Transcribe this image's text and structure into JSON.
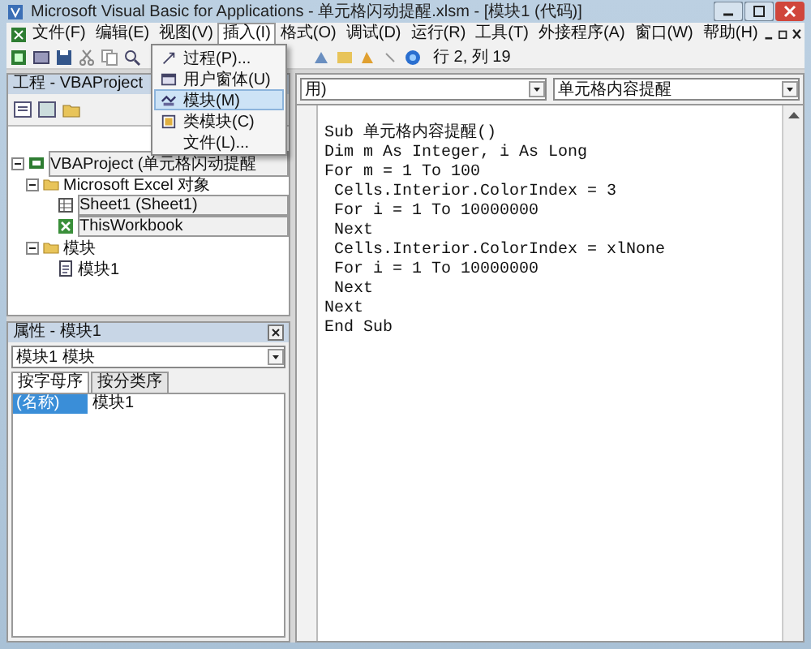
{
  "window": {
    "title": "Microsoft Visual Basic for Applications - 单元格闪动提醒.xlsm - [模块1 (代码)]"
  },
  "menu_bar": [
    {
      "label": "文件(F)",
      "selected": false
    },
    {
      "label": "编辑(E)",
      "selected": false
    },
    {
      "label": "视图(V)",
      "selected": false
    },
    {
      "label": "插入(I)",
      "selected": true
    },
    {
      "label": "格式(O)",
      "selected": false
    },
    {
      "label": "调试(D)",
      "selected": false
    },
    {
      "label": "运行(R)",
      "selected": false
    },
    {
      "label": "工具(T)",
      "selected": false
    },
    {
      "label": "外接程序(A)",
      "selected": false
    },
    {
      "label": "窗口(W)",
      "selected": false
    },
    {
      "label": "帮助(H)",
      "selected": false
    }
  ],
  "insert_menu": {
    "items": [
      {
        "label": "过程(P)...",
        "selected": false
      },
      {
        "label": "用户窗体(U)",
        "selected": false
      },
      {
        "label": "模块(M)",
        "selected": true
      },
      {
        "label": "类模块(C)",
        "selected": false
      },
      {
        "label": "文件(L)...",
        "selected": false
      }
    ]
  },
  "toolbar": {
    "position": "行 2, 列 19"
  },
  "project_pane": {
    "title": "工程 - VBAProject",
    "tree": [
      {
        "label": "VBAProject (单元格闪动提醒",
        "kind": "project",
        "expanded": true,
        "children": [
          {
            "label": "Microsoft Excel 对象",
            "kind": "folder",
            "expanded": true,
            "children": [
              {
                "label": "Sheet1 (Sheet1)",
                "kind": "sheet"
              },
              {
                "label": "ThisWorkbook",
                "kind": "workbook"
              }
            ]
          },
          {
            "label": "模块",
            "kind": "folder",
            "expanded": true,
            "children": [
              {
                "label": "模块1",
                "kind": "module"
              }
            ]
          }
        ]
      }
    ]
  },
  "properties_pane": {
    "title": "属性 - 模块1",
    "object": "模块1 模块",
    "tabs": [
      {
        "label": "按字母序",
        "selected": true
      },
      {
        "label": "按分类序",
        "selected": false
      }
    ],
    "rows": [
      {
        "name": "(名称)",
        "value": "模块1",
        "selected": true
      }
    ]
  },
  "code_window": {
    "object": "用)",
    "procedure": "单元格内容提醒",
    "lines": [
      "Sub 单元格内容提醒()",
      "Dim m As Integer, i As Long",
      "For m = 1 To 100",
      " Cells.Interior.ColorIndex = 3",
      " For i = 1 To 10000000",
      " Next",
      " Cells.Interior.ColorIndex = xlNone",
      " For i = 1 To 10000000",
      " Next",
      "Next",
      "End Sub"
    ]
  }
}
